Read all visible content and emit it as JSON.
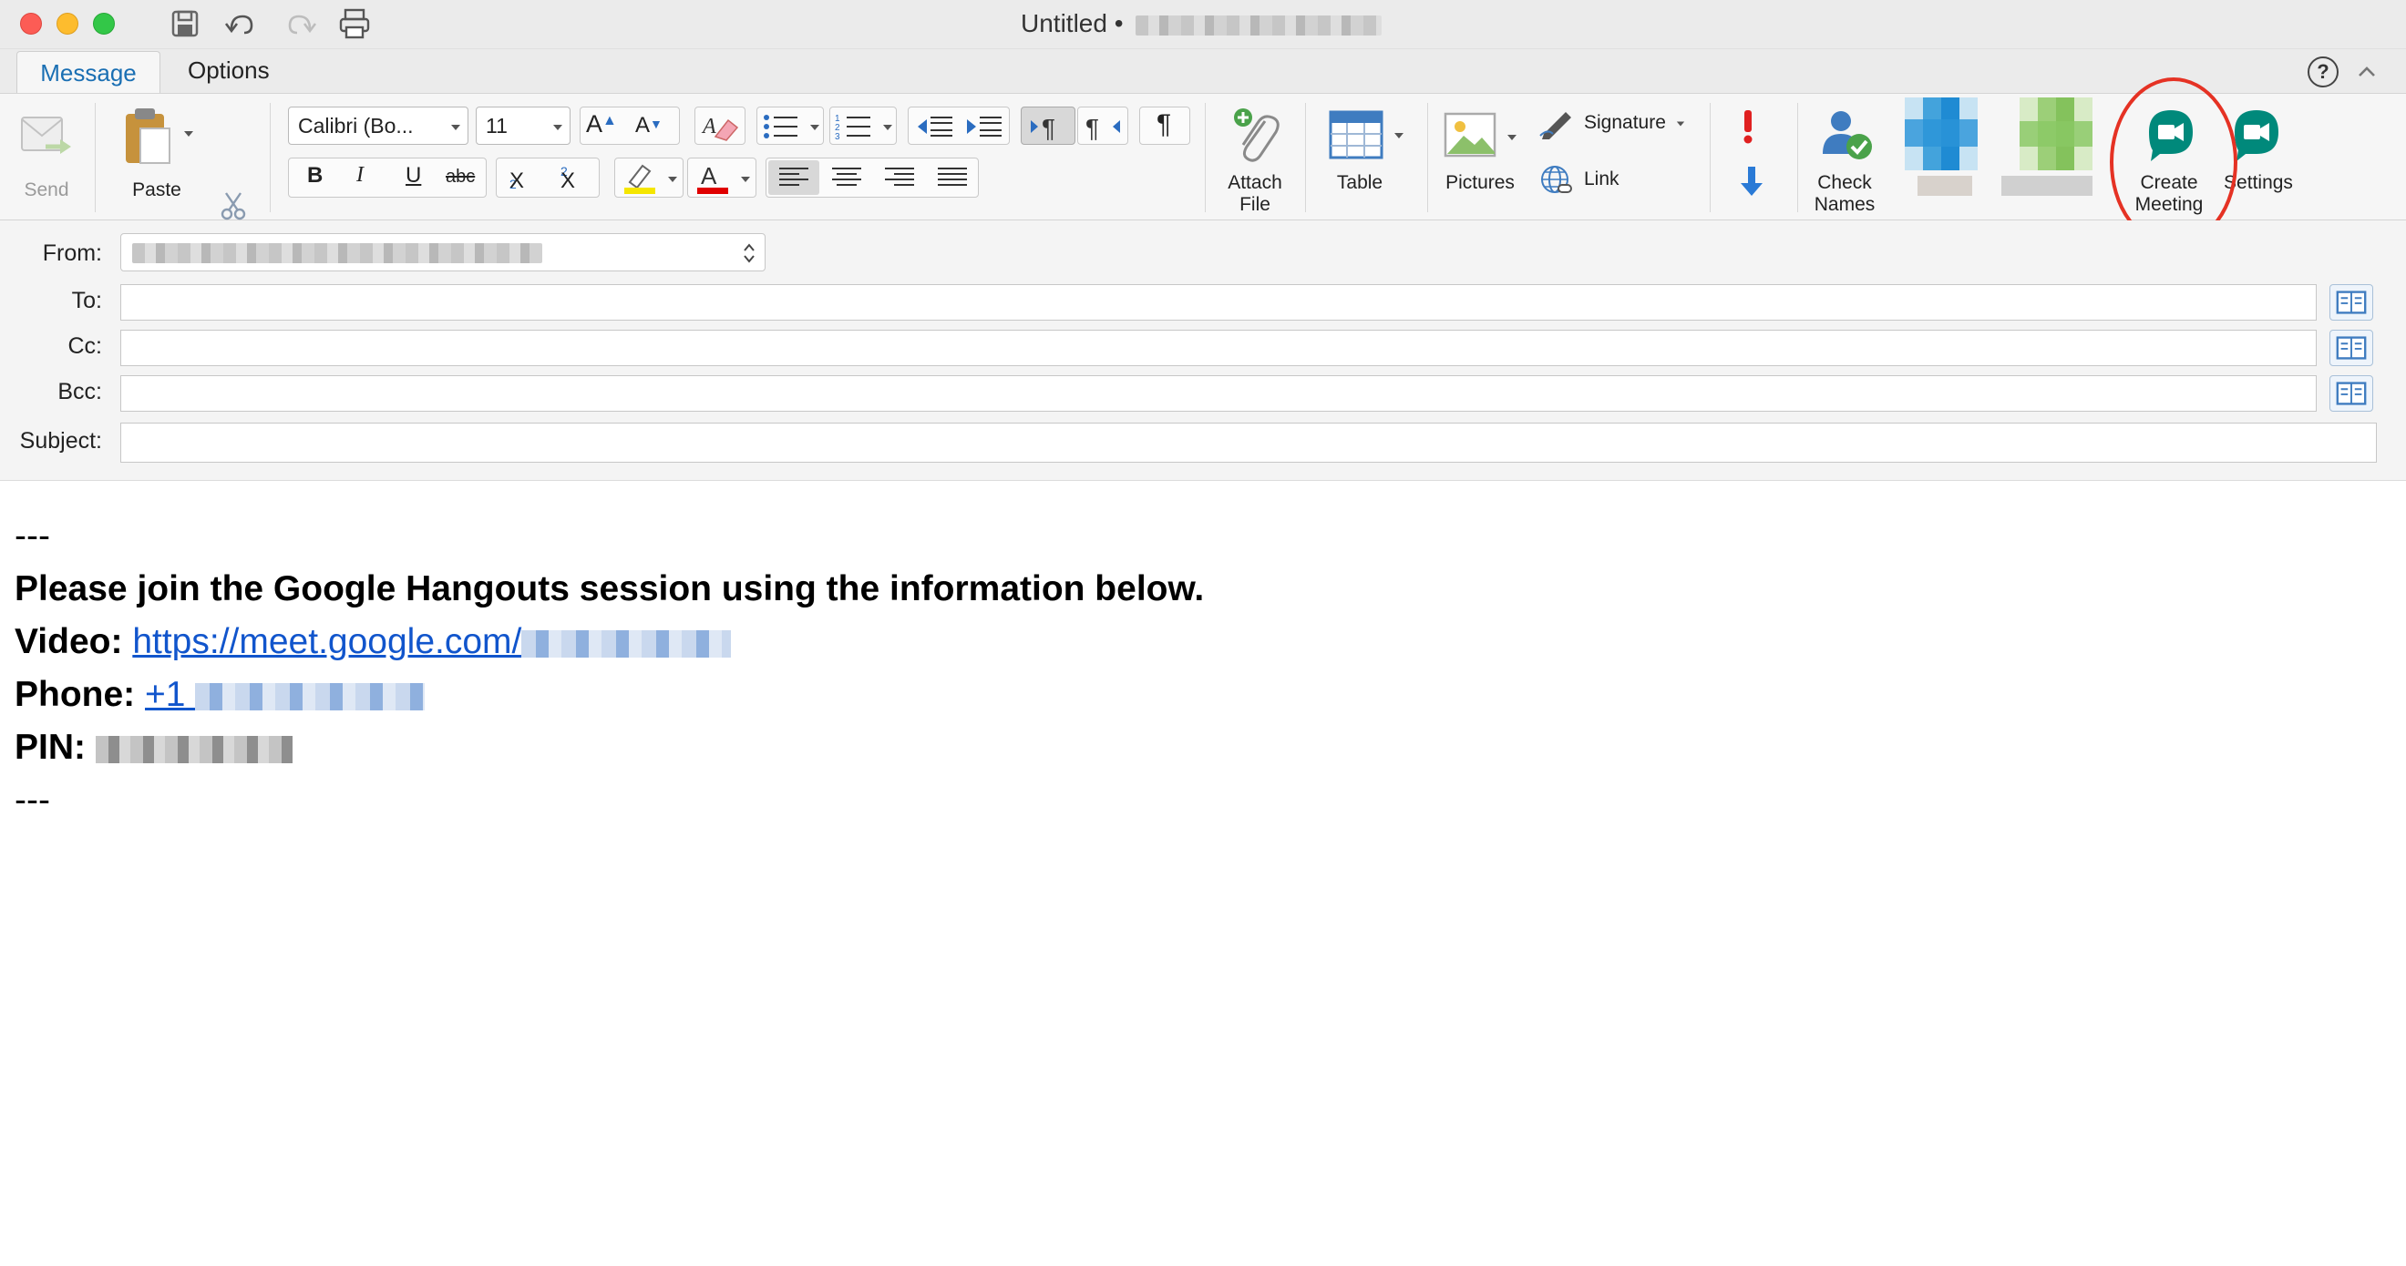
{
  "window": {
    "title": "Untitled •"
  },
  "tabs": [
    {
      "label": "Message"
    },
    {
      "label": "Options"
    }
  ],
  "help": {
    "glyph": "?"
  },
  "ribbon": {
    "send": "Send",
    "paste": "Paste",
    "font_name": "Calibri (Bo...",
    "font_size": "11",
    "bold": "B",
    "italic": "I",
    "underline": "U",
    "strikethrough": "abc",
    "subscript": "X",
    "superscript": "X",
    "attach_file": "Attach\nFile",
    "table": "Table",
    "pictures": "Pictures",
    "signature": "Signature",
    "link": "Link",
    "check_names": "Check\nNames",
    "create_meeting": "Create\nMeeting",
    "settings": "Settings"
  },
  "fields": {
    "from_label": "From:",
    "to_label": "To:",
    "cc_label": "Cc:",
    "bcc_label": "Bcc:",
    "subject_label": "Subject:"
  },
  "body": {
    "sep_top": "---",
    "line1": "Please join the Google Hangouts session using the information below.",
    "video_label": "Video:",
    "video_link": "https://meet.google.com/",
    "phone_label": "Phone:",
    "phone_link": "+1",
    "pin_label": "PIN:",
    "sep_bottom": "---"
  },
  "colors": {
    "accent": "#1a6fb3",
    "meet_green": "#00897b",
    "annotation_red": "#e53224",
    "link": "#1155cc"
  }
}
